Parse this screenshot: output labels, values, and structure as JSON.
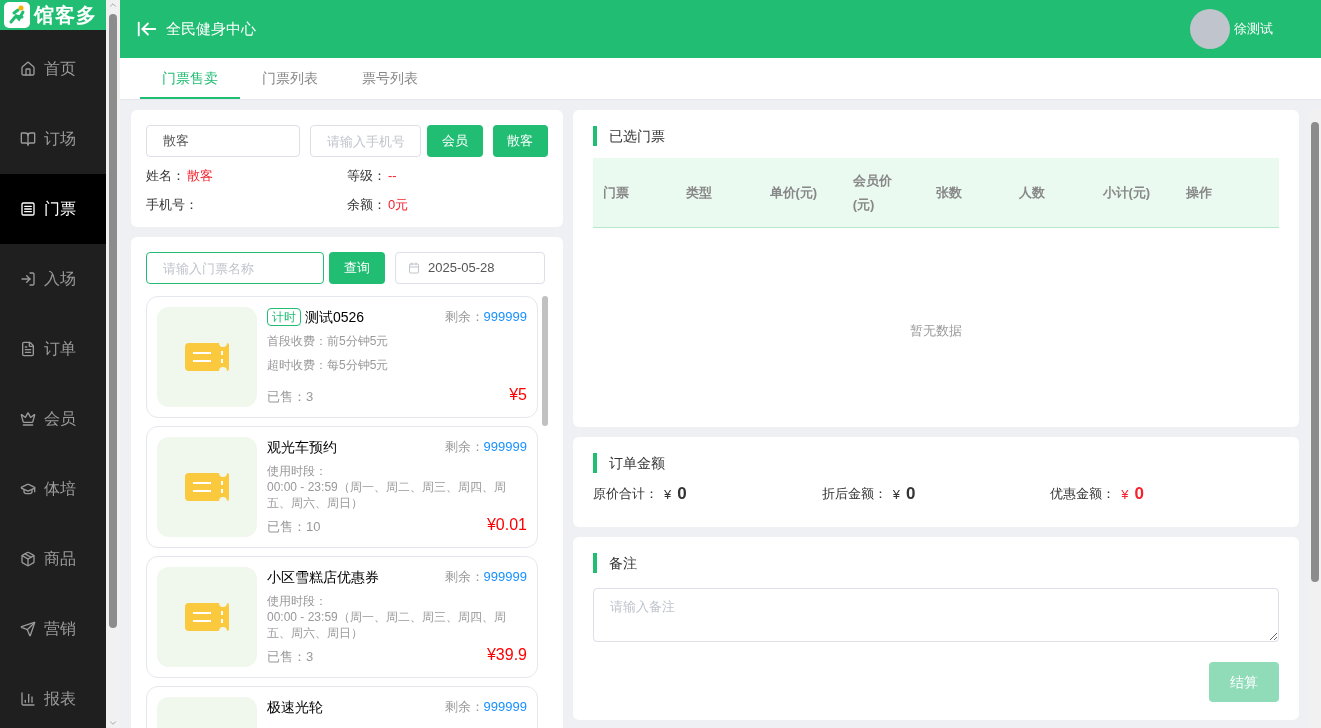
{
  "brand": {
    "name": "馆客多"
  },
  "sidebar": {
    "items": [
      {
        "label": "首页",
        "selected": false
      },
      {
        "label": "订场",
        "selected": false
      },
      {
        "label": "门票",
        "selected": true
      },
      {
        "label": "入场",
        "selected": false
      },
      {
        "label": "订单",
        "selected": false
      },
      {
        "label": "会员",
        "selected": false
      },
      {
        "label": "体培",
        "selected": false
      },
      {
        "label": "商品",
        "selected": false
      },
      {
        "label": "营销",
        "selected": false
      },
      {
        "label": "报表",
        "selected": false
      }
    ]
  },
  "header": {
    "venue": "全民健身中心",
    "user": "徐测试"
  },
  "tabs": [
    {
      "label": "门票售卖",
      "selected": true
    },
    {
      "label": "门票列表",
      "selected": false
    },
    {
      "label": "票号列表",
      "selected": false
    }
  ],
  "customer": {
    "type_value": "散客",
    "phone_placeholder": "请输入手机号",
    "buttons": [
      "会员",
      "散客"
    ],
    "name_label": "姓名：",
    "name": "散客",
    "level_label": "等级：",
    "grade": "--",
    "phone_label": "手机号：",
    "balance_label": "余额：",
    "balance": "0元"
  },
  "ticket_search": {
    "placeholder": "请输入门票名称",
    "button": "查询",
    "date": "2025-05-28"
  },
  "tickets": [
    {
      "tag": "计时",
      "name": "测试0526",
      "remain_label": "剩余：",
      "remain": "999999",
      "details": [
        "首段收费：前5分钟5元",
        "超时收费：每5分钟5元"
      ],
      "sold": "已售：3",
      "price": "¥5"
    },
    {
      "name": "观光车预约",
      "remain_label": "剩余：",
      "remain": "999999",
      "details": [
        "使用时段：",
        "00:00 - 23:59（周一、周二、周三、周四、周五、周六、周日）"
      ],
      "sold": "已售：10",
      "price": "¥0.01"
    },
    {
      "name": "小区雪糕店优惠券",
      "remain_label": "剩余：",
      "remain": "999999",
      "details": [
        "使用时段：",
        "00:00 - 23:59（周一、周二、周三、周四、周五、周六、周日）"
      ],
      "sold": "已售：3",
      "price": "¥39.9"
    },
    {
      "name": "极速光轮",
      "remain_label": "剩余：",
      "remain": "999999"
    }
  ],
  "selected_tickets": {
    "title": "已选门票",
    "columns": [
      "门票",
      "类型",
      "单价(元)",
      "会员价(元)",
      "张数",
      "人数",
      "小计(元)",
      "操作"
    ],
    "empty": "暂无数据"
  },
  "order_amount": {
    "title": "订单金额",
    "items": [
      {
        "label": "原价合计：",
        "currency": "¥",
        "value": "0",
        "highlight": false
      },
      {
        "label": "折后金额：",
        "currency": "¥",
        "value": "0",
        "highlight": false
      },
      {
        "label": "优惠金额：",
        "currency": "¥",
        "value": "0",
        "highlight": true
      }
    ]
  },
  "remarks": {
    "title": "备注",
    "placeholder": "请输入备注",
    "submit": "结算",
    "submit_disabled": true
  }
}
